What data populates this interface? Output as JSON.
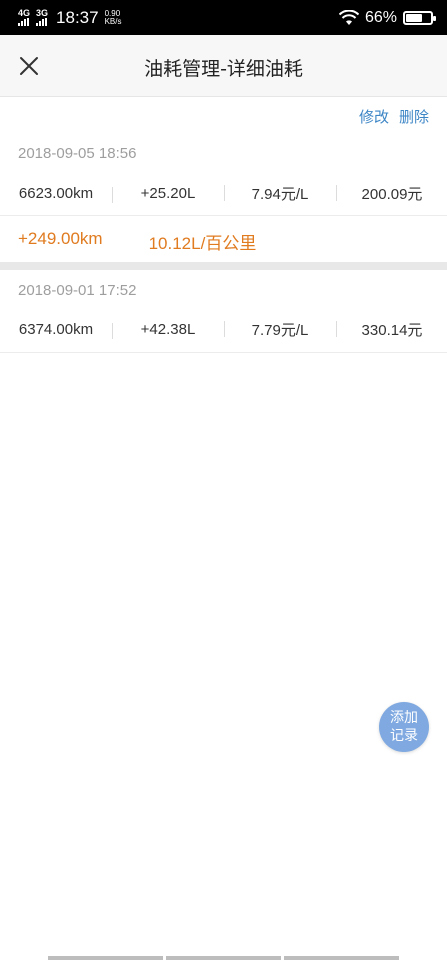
{
  "status_bar": {
    "network1": "4G",
    "network2": "3G",
    "time": "18:37",
    "speed_value": "0.90",
    "speed_unit": "KB/s",
    "battery": "66%",
    "battery_level": 0.66
  },
  "header": {
    "title": "油耗管理-详细油耗",
    "close_icon": "close-icon"
  },
  "actions": {
    "edit": "修改",
    "delete": "删除"
  },
  "records": [
    {
      "datetime": "2018-09-05 18:56",
      "mileage": "6623.00km",
      "fuel": "+25.20L",
      "price": "7.94元/L",
      "cost": "200.09元",
      "distance": "+249.00km",
      "consumption": "10.12L/百公里"
    },
    {
      "datetime": "2018-09-01 17:52",
      "mileage": "6374.00km",
      "fuel": "+42.38L",
      "price": "7.79元/L",
      "cost": "330.14元"
    }
  ],
  "fab": {
    "line1": "添加",
    "line2": "记录"
  },
  "colors": {
    "accent_blue": "#3d86c6",
    "summary_orange": "#e07b20",
    "fab_blue": "#7fa9e0"
  }
}
